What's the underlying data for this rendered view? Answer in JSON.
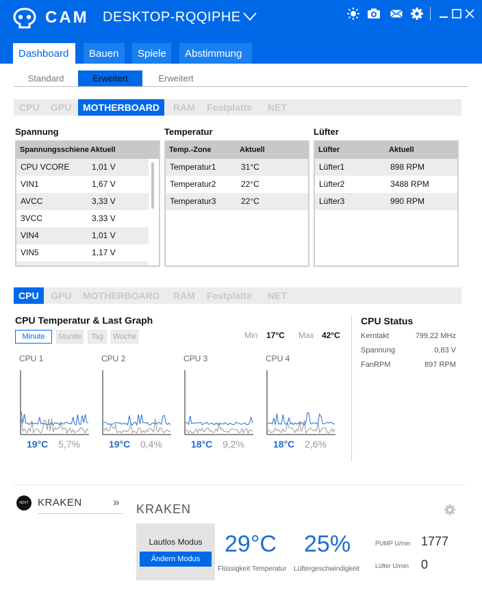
{
  "app": {
    "brand": "CAM",
    "machine_name": "DESKTOP-RQQIPHE",
    "header_icons": [
      "brightness-icon",
      "camera-icon",
      "mail-icon",
      "gear-icon"
    ],
    "window_buttons": [
      "minimize-icon",
      "maximize-icon",
      "close-icon"
    ],
    "accent_color": "#0069e8"
  },
  "main_tabs": [
    {
      "label": "Dashboard",
      "active": true
    },
    {
      "label": "Bauen",
      "active": false
    },
    {
      "label": "Spiele",
      "active": false
    },
    {
      "label": "Abstimmung",
      "active": false
    }
  ],
  "sub_tabs": [
    {
      "label": "Standard",
      "active": false
    },
    {
      "label": "Erweitert",
      "active": true
    },
    {
      "label": "Erweitert",
      "active": false
    }
  ],
  "category_tabs_top": [
    {
      "label": "CPU"
    },
    {
      "label": "GPU"
    },
    {
      "label": "MOTHERBOARD",
      "active": true
    },
    {
      "label": "RAM"
    },
    {
      "label": "Festplatte"
    },
    {
      "label": "NET"
    }
  ],
  "spannung": {
    "title": "Spannung",
    "headers": [
      "Spannungsschiene",
      "Aktuell"
    ],
    "rows": [
      [
        "CPU VCORE",
        "1,01 V"
      ],
      [
        "VIN1",
        "1,67 V"
      ],
      [
        "AVCC",
        "3,33 V"
      ],
      [
        "3VCC",
        "3,33 V"
      ],
      [
        "VIN4",
        "1,01 V"
      ],
      [
        "VIN5",
        "1,17 V"
      ]
    ]
  },
  "temperatur": {
    "title": "Temperatur",
    "headers": [
      "Temp.-Zone",
      "Aktuell"
    ],
    "rows": [
      [
        "Temperatur1",
        "31°C"
      ],
      [
        "Temperatur2",
        "22°C"
      ],
      [
        "Temperatur3",
        "22°C"
      ]
    ]
  },
  "luefter": {
    "title": "Lüfter",
    "headers": [
      "Lüfter",
      "Aktuell"
    ],
    "rows": [
      [
        "Lüfter1",
        "898 RPM"
      ],
      [
        "Lüfter2",
        "3488 RPM"
      ],
      [
        "Lüfter3",
        "990 RPM"
      ]
    ]
  },
  "category_tabs_bottom": [
    {
      "label": "CPU",
      "active": true
    },
    {
      "label": "GPU"
    },
    {
      "label": "MOTHERBOARD"
    },
    {
      "label": "RAM"
    },
    {
      "label": "Festplatte"
    },
    {
      "label": "NET"
    }
  ],
  "graph": {
    "title": "CPU Temperatur & Last Graph",
    "ranges": [
      {
        "label": "Minute",
        "active": true
      },
      {
        "label": "Stunde"
      },
      {
        "label": "Tag"
      },
      {
        "label": "Woche"
      }
    ],
    "min_label": "Min",
    "min_value": "17°C",
    "max_label": "Max",
    "max_value": "42°C",
    "cores": [
      {
        "name": "CPU 1",
        "temp": "19°C",
        "load": "5,7%"
      },
      {
        "name": "CPU 2",
        "temp": "19°C",
        "load": "0,4%"
      },
      {
        "name": "CPU 3",
        "temp": "18°C",
        "load": "9,2%"
      },
      {
        "name": "CPU 4",
        "temp": "18°C",
        "load": "2,6%"
      }
    ],
    "temp_color": "#1f6ccf",
    "load_color": "#999999"
  },
  "cpu_status": {
    "title": "CPU Status",
    "items": [
      {
        "label": "Kerntakt",
        "value": "799,22 MHz"
      },
      {
        "label": "Spannung",
        "value": "0,83 V"
      },
      {
        "label": "FanRPM",
        "value": "897 RPM"
      }
    ]
  },
  "kraken": {
    "logo_text": "NZXT",
    "device_name": "KRAKEN",
    "arrow": "»",
    "title": "KRAKEN",
    "mode_label": "Lautlos Modus",
    "mode_button": "Ändern Modus",
    "liquid_temp": "29°C",
    "liquid_temp_label": "Flüssigkeit Temperatur",
    "fan_speed": "25%",
    "fan_speed_label": "Lüftergeschwindigkeit",
    "pump_label": "PUMP U/min",
    "pump_value": "1777",
    "fan_label": "Lüfter U/min",
    "fan_value": "0"
  }
}
